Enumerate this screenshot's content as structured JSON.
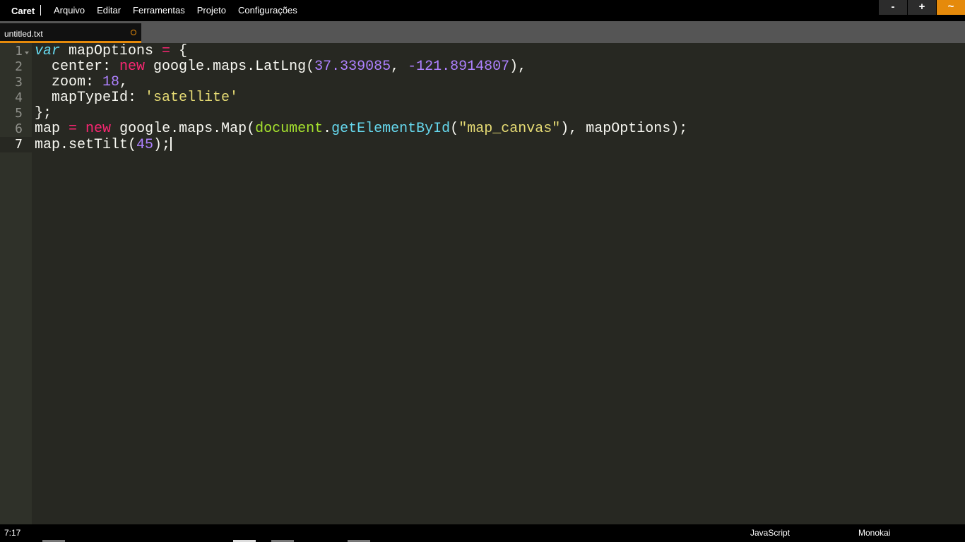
{
  "app": {
    "name": "Caret",
    "menus": [
      "Arquivo",
      "Editar",
      "Ferramentas",
      "Projeto",
      "Configurações"
    ]
  },
  "window_controls": {
    "minimize": "-",
    "maximize": "+",
    "close": "~",
    "accent_color": "#e58a0b"
  },
  "tab": {
    "title": "untitled.txt",
    "modified_indicator": "dot"
  },
  "editor": {
    "theme_colors": {
      "background": "#272822",
      "gutter": "#2f3129",
      "text": "#f8f8f2",
      "keyword": "#f92672",
      "storage": "#66d9ef",
      "number": "#ae81ff",
      "string": "#e6db74",
      "global": "#a6e22e"
    },
    "line_numbers": [
      "1",
      "2",
      "3",
      "4",
      "5",
      "6",
      "7"
    ],
    "active_line": 7,
    "lines": [
      [
        {
          "t": "var",
          "c": "kw-i"
        },
        {
          "t": " mapOptions ",
          "c": ""
        },
        {
          "t": "=",
          "c": "op"
        },
        {
          "t": " {",
          "c": ""
        }
      ],
      [
        {
          "t": "  center: ",
          "c": ""
        },
        {
          "t": "new",
          "c": "kw"
        },
        {
          "t": " google.maps.LatLng(",
          "c": ""
        },
        {
          "t": "37.339085",
          "c": "num"
        },
        {
          "t": ", ",
          "c": ""
        },
        {
          "t": "-121.8914807",
          "c": "num"
        },
        {
          "t": "),",
          "c": ""
        }
      ],
      [
        {
          "t": "  zoom: ",
          "c": ""
        },
        {
          "t": "18",
          "c": "num"
        },
        {
          "t": ",",
          "c": ""
        }
      ],
      [
        {
          "t": "  mapTypeId: ",
          "c": ""
        },
        {
          "t": "'satellite'",
          "c": "str"
        }
      ],
      [
        {
          "t": "};",
          "c": ""
        }
      ],
      [
        {
          "t": "map ",
          "c": ""
        },
        {
          "t": "=",
          "c": "op"
        },
        {
          "t": " ",
          "c": ""
        },
        {
          "t": "new",
          "c": "kw"
        },
        {
          "t": " google.maps.Map(",
          "c": ""
        },
        {
          "t": "document",
          "c": "glob"
        },
        {
          "t": ".",
          "c": ""
        },
        {
          "t": "getElementById",
          "c": "fn"
        },
        {
          "t": "(",
          "c": ""
        },
        {
          "t": "\"map_canvas\"",
          "c": "str"
        },
        {
          "t": "), mapOptions);",
          "c": ""
        }
      ],
      [
        {
          "t": "map.setTilt(",
          "c": ""
        },
        {
          "t": "45",
          "c": "num"
        },
        {
          "t": ");",
          "c": ""
        }
      ]
    ]
  },
  "status": {
    "cursor_position": "7:17",
    "language_mode": "JavaScript",
    "theme": "Monokai"
  }
}
